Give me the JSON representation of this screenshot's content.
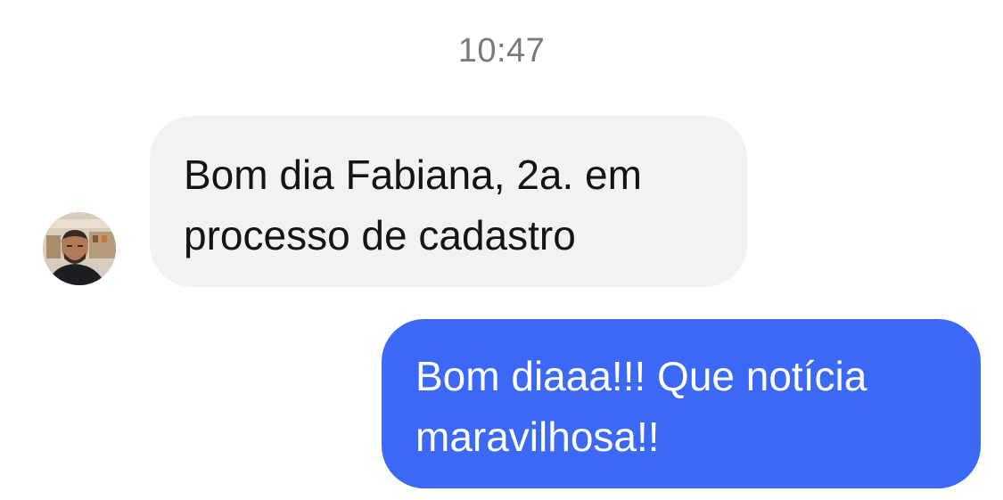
{
  "chat": {
    "timestamp": "10:47",
    "messages": [
      {
        "direction": "incoming",
        "lines": [
          "Bom dia Fabiana, 2a. em",
          "processo de cadastro"
        ]
      },
      {
        "direction": "outgoing",
        "lines": [
          "Bom diaaa!!! Que notícia",
          "maravilhosa!!"
        ]
      }
    ]
  },
  "colors": {
    "incoming_bubble": "#f2f2f4",
    "outgoing_bubble": "#3b69f6",
    "timestamp_text": "#7a7a7e"
  }
}
